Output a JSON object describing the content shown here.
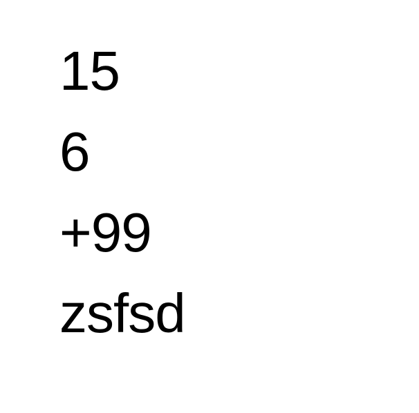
{
  "document": {
    "lines": [
      "15",
      "6",
      "+99",
      "zsfsd"
    ]
  }
}
